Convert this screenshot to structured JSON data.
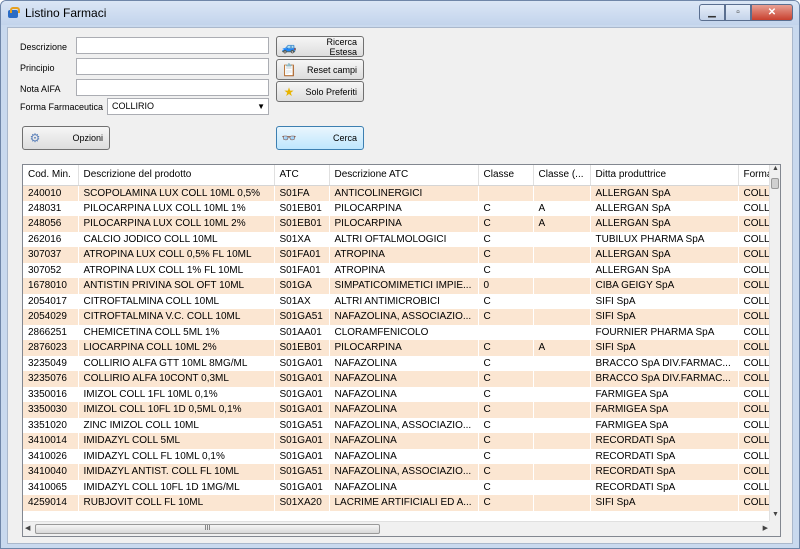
{
  "window": {
    "title": "Listino Farmaci"
  },
  "form": {
    "descrizione_label": "Descrizione",
    "descrizione_value": "",
    "principio_label": "Principio",
    "principio_value": "",
    "nota_label": "Nota AIFA",
    "nota_value": "",
    "forma_label": "Forma Farmaceutica",
    "forma_value": "COLLIRIO"
  },
  "buttons": {
    "ricerca": "Ricerca Estesa",
    "reset": "Reset campi",
    "preferiti": "Solo Preferiti",
    "opzioni": "Opzioni",
    "cerca": "Cerca"
  },
  "grid": {
    "columns": [
      "Cod. Min.",
      "Descrizione del prodotto",
      "ATC",
      "Descrizione ATC",
      "Classe",
      "Classe (...",
      "Ditta produttrice",
      "Forma"
    ],
    "rows": [
      [
        "240010",
        "SCOPOLAMINA LUX COLL 10ML 0,5%",
        "S01FA",
        "ANTICOLINERGICI",
        "",
        "",
        "ALLERGAN SpA",
        "COLL"
      ],
      [
        "248031",
        "PILOCARPINA LUX COLL 10ML 1%",
        "S01EB01",
        "PILOCARPINA",
        "C",
        "A",
        "ALLERGAN SpA",
        "COLL"
      ],
      [
        "248056",
        "PILOCARPINA LUX COLL 10ML 2%",
        "S01EB01",
        "PILOCARPINA",
        "C",
        "A",
        "ALLERGAN SpA",
        "COLL"
      ],
      [
        "262016",
        "CALCIO JODICO COLL 10ML",
        "S01XA",
        "ALTRI OFTALMOLOGICI",
        "C",
        "",
        "TUBILUX PHARMA SpA",
        "COLL"
      ],
      [
        "307037",
        "ATROPINA LUX COLL 0,5% FL 10ML",
        "S01FA01",
        "ATROPINA",
        "C",
        "",
        "ALLERGAN SpA",
        "COLL"
      ],
      [
        "307052",
        "ATROPINA LUX COLL 1% FL 10ML",
        "S01FA01",
        "ATROPINA",
        "C",
        "",
        "ALLERGAN SpA",
        "COLL"
      ],
      [
        "1678010",
        "ANTISTIN PRIVINA SOL OFT 10ML",
        "S01GA",
        "SIMPATICOMIMETICI IMPIE...",
        "0",
        "",
        "CIBA GEIGY SpA",
        "COLL"
      ],
      [
        "2054017",
        "CITROFTALMINA COLL 10ML",
        "S01AX",
        "ALTRI ANTIMICROBICI",
        "C",
        "",
        "SIFI SpA",
        "COLL"
      ],
      [
        "2054029",
        "CITROFTALMINA V.C. COLL 10ML",
        "S01GA51",
        "NAFAZOLINA, ASSOCIAZIO...",
        "C",
        "",
        "SIFI SpA",
        "COLL"
      ],
      [
        "2866251",
        "CHEMICETINA COLL 5ML 1%",
        "S01AA01",
        "CLORAMFENICOLO",
        "",
        "",
        "FOURNIER PHARMA SpA",
        "COLL"
      ],
      [
        "2876023",
        "LIOCARPINA COLL 10ML 2%",
        "S01EB01",
        "PILOCARPINA",
        "C",
        "A",
        "SIFI SpA",
        "COLL"
      ],
      [
        "3235049",
        "COLLIRIO ALFA GTT 10ML 8MG/ML",
        "S01GA01",
        "NAFAZOLINA",
        "C",
        "",
        "BRACCO SpA DIV.FARMAC...",
        "COLL"
      ],
      [
        "3235076",
        "COLLIRIO ALFA 10CONT 0,3ML",
        "S01GA01",
        "NAFAZOLINA",
        "C",
        "",
        "BRACCO SpA DIV.FARMAC...",
        "COLL"
      ],
      [
        "3350016",
        "IMIZOL COLL 1FL 10ML 0,1%",
        "S01GA01",
        "NAFAZOLINA",
        "C",
        "",
        "FARMIGEA SpA",
        "COLL"
      ],
      [
        "3350030",
        "IMIZOL COLL 10FL 1D 0,5ML 0,1%",
        "S01GA01",
        "NAFAZOLINA",
        "C",
        "",
        "FARMIGEA SpA",
        "COLL"
      ],
      [
        "3351020",
        "ZINC IMIZOL COLL 10ML",
        "S01GA51",
        "NAFAZOLINA, ASSOCIAZIO...",
        "C",
        "",
        "FARMIGEA SpA",
        "COLL"
      ],
      [
        "3410014",
        "IMIDAZYL COLL 5ML",
        "S01GA01",
        "NAFAZOLINA",
        "C",
        "",
        "RECORDATI SpA",
        "COLL"
      ],
      [
        "3410026",
        "IMIDAZYL COLL FL 10ML 0,1%",
        "S01GA01",
        "NAFAZOLINA",
        "C",
        "",
        "RECORDATI SpA",
        "COLL"
      ],
      [
        "3410040",
        "IMIDAZYL ANTIST. COLL FL 10ML",
        "S01GA51",
        "NAFAZOLINA, ASSOCIAZIO...",
        "C",
        "",
        "RECORDATI SpA",
        "COLL"
      ],
      [
        "3410065",
        "IMIDAZYL COLL 10FL 1D 1MG/ML",
        "S01GA01",
        "NAFAZOLINA",
        "C",
        "",
        "RECORDATI SpA",
        "COLL"
      ],
      [
        "4259014",
        "RUBJOVIT COLL FL 10ML",
        "S01XA20",
        "LACRIME ARTIFICIALI ED A...",
        "C",
        "",
        "SIFI SpA",
        "COLL"
      ]
    ]
  },
  "scroll": {
    "h_grip": "III"
  }
}
